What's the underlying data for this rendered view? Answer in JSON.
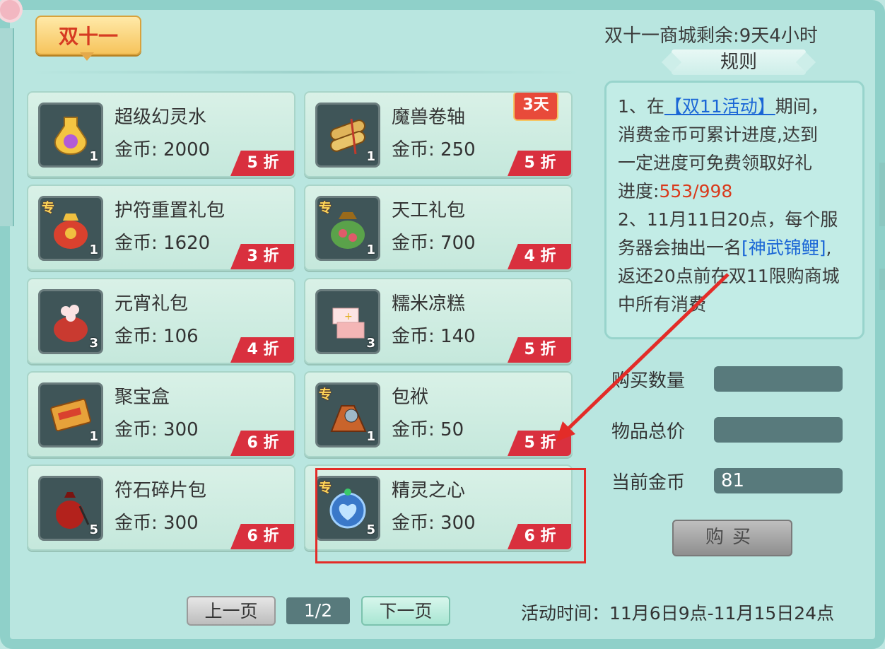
{
  "tab_label": "双十一",
  "remaining_text": "双十一商城剩余:9天4小时",
  "rules": {
    "title": "规则",
    "line1_pre": "1、在",
    "line1_link": "【双11活动】",
    "line1_post": "期间，",
    "line2": "消费金币可累计进度,达到",
    "line3": "一定进度可免费领取好礼",
    "progress_label": "进度:",
    "progress_value": "553/998",
    "line5": "2、11月11日20点，每个服",
    "line6_pre": "务器会抽出一名",
    "line6_link": "[神武锦鲤]",
    "line6_post": ",",
    "line7": "返还20点前在双11限购商城",
    "line8": "中所有消费"
  },
  "items": [
    {
      "name": "超级幻灵水",
      "price": "金币: 2000",
      "discount": "5 折",
      "count": "1",
      "zhuan": "",
      "badge": "",
      "icon": "potion-icon",
      "color": "#f4c542"
    },
    {
      "name": "魔兽卷轴",
      "price": "金币: 250",
      "discount": "5 折",
      "count": "1",
      "zhuan": "",
      "badge": "3天",
      "icon": "scroll-icon",
      "color": "#e0b45a"
    },
    {
      "name": "护符重置礼包",
      "price": "金币: 1620",
      "discount": "3 折",
      "count": "1",
      "zhuan": "专",
      "badge": "",
      "icon": "gift-bag-icon",
      "color": "#d9412e"
    },
    {
      "name": "天工礼包",
      "price": "金币: 700",
      "discount": "4 折",
      "count": "1",
      "zhuan": "专",
      "badge": "",
      "icon": "green-bag-icon",
      "color": "#5aa24a"
    },
    {
      "name": "元宵礼包",
      "price": "金币: 106",
      "discount": "4 折",
      "count": "3",
      "zhuan": "",
      "badge": "",
      "icon": "red-bag-icon",
      "color": "#c93a30"
    },
    {
      "name": "糯米凉糕",
      "price": "金币: 140",
      "discount": "5 折",
      "count": "3",
      "zhuan": "",
      "badge": "",
      "icon": "cake-icon",
      "color": "#f4b6b6"
    },
    {
      "name": "聚宝盒",
      "price": "金币: 300",
      "discount": "6 折",
      "count": "1",
      "zhuan": "",
      "badge": "",
      "icon": "treasure-box-icon",
      "color": "#e7a23a"
    },
    {
      "name": "包袱",
      "price": "金币: 50",
      "discount": "5 折",
      "count": "1",
      "zhuan": "专",
      "badge": "",
      "icon": "bundle-icon",
      "color": "#c9642b"
    },
    {
      "name": "符石碎片包",
      "price": "金币: 300",
      "discount": "6 折",
      "count": "5",
      "zhuan": "",
      "badge": "",
      "icon": "rune-bag-icon",
      "color": "#b3221c"
    },
    {
      "name": "精灵之心",
      "price": "金币: 300",
      "discount": "6 折",
      "count": "5",
      "zhuan": "专",
      "badge": "",
      "icon": "spirit-heart-icon",
      "color": "#3a78c9"
    }
  ],
  "form": {
    "qty_label": "购买数量",
    "total_label": "物品总价",
    "coins_label": "当前金币",
    "qty_value": "",
    "total_value": "",
    "coins_value": "81",
    "buy_label": "购买"
  },
  "pager": {
    "prev": "上一页",
    "page": "1/2",
    "next": "下一页"
  },
  "activity_time": "活动时间：11月6日9点-11月15日24点",
  "colors": {
    "accent": "#d9303e",
    "link": "#1a66d6",
    "progress": "#d93a1c",
    "highlight": "#e32c28"
  }
}
